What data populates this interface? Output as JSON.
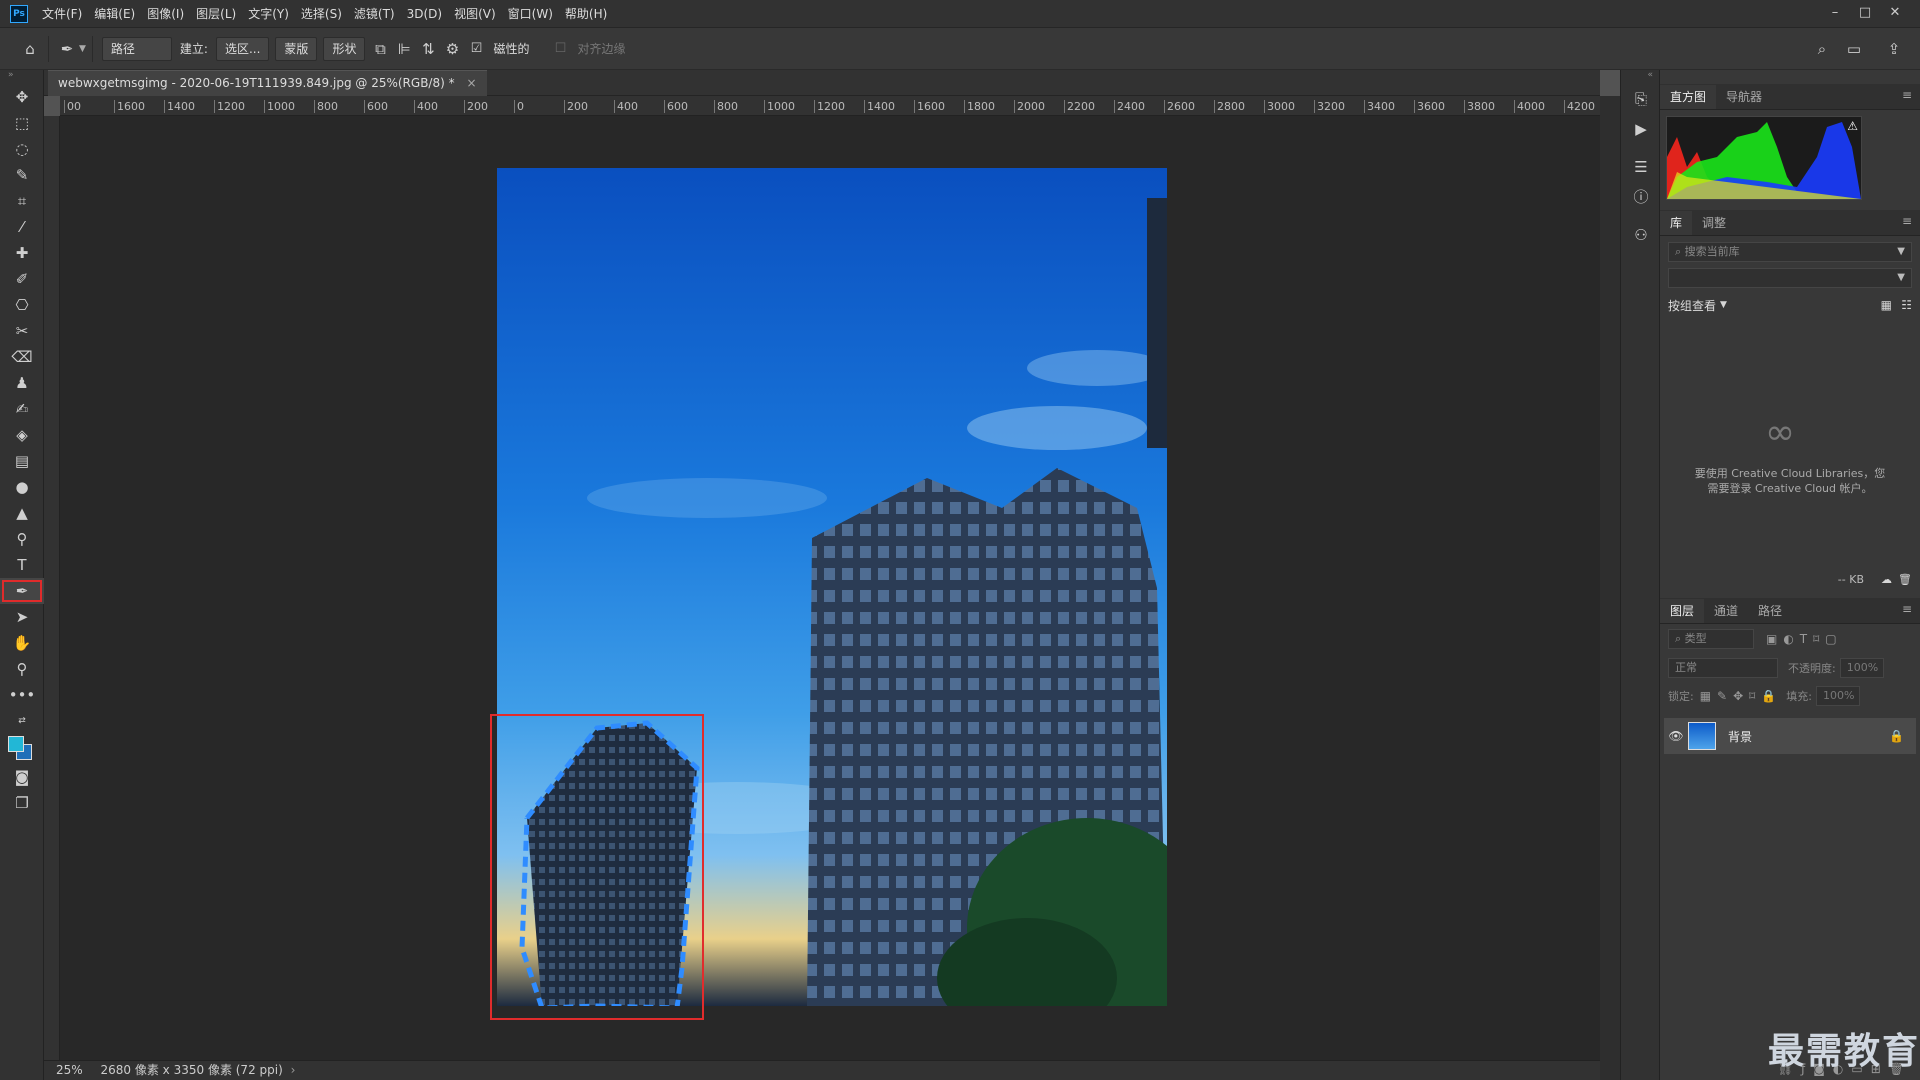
{
  "menu": {
    "items": [
      "文件(F)",
      "编辑(E)",
      "图像(I)",
      "图层(L)",
      "文字(Y)",
      "选择(S)",
      "滤镜(T)",
      "3D(D)",
      "视图(V)",
      "窗口(W)",
      "帮助(H)"
    ],
    "logo": "Ps"
  },
  "options": {
    "mode": "路径",
    "build_label": "建立:",
    "selection_btn": "选区...",
    "mask_btn": "蒙版",
    "shape_btn": "形状",
    "magnetic_label": "磁性的",
    "align_edges_label": "对齐边缘"
  },
  "document": {
    "tab_title": "webwxgetmsgimg - 2020-06-19T111939.849.jpg @ 25%(RGB/8) *",
    "close": "×"
  },
  "ruler": {
    "ticks": [
      "00",
      "1600",
      "1400",
      "1200",
      "1000",
      "800",
      "600",
      "400",
      "200",
      "0",
      "200",
      "400",
      "600",
      "800",
      "1000",
      "1200",
      "1400",
      "1600",
      "1800",
      "2000",
      "2200",
      "2400",
      "2600",
      "2800",
      "3000",
      "3200",
      "3400",
      "3600",
      "3800",
      "4000",
      "4200"
    ]
  },
  "status": {
    "zoom": "25%",
    "info": "2680 像素 x 3350 像素 (72 ppi)"
  },
  "panels": {
    "top_tabs": [
      "直方图",
      "导航器"
    ],
    "lib_tabs": [
      "库",
      "调整"
    ],
    "search_placeholder": "搜索当前库",
    "group_view": "按组查看",
    "cc_message": "要使用 Creative Cloud Libraries，您需要登录 Creative Cloud 帐户。",
    "kb": "-- KB",
    "layer_tabs": [
      "图层",
      "通道",
      "路径"
    ],
    "filter_placeholder": "类型",
    "blend_mode": "正常",
    "opacity_label": "不透明度:",
    "opacity_value": "100%",
    "lock_label": "锁定:",
    "fill_label": "填充:",
    "fill_value": "100%",
    "layer_name": "背景"
  },
  "watermark": "最需教育",
  "colors": {
    "accent_selection": "#e12c2c",
    "path_outline": "#2f8cff"
  }
}
